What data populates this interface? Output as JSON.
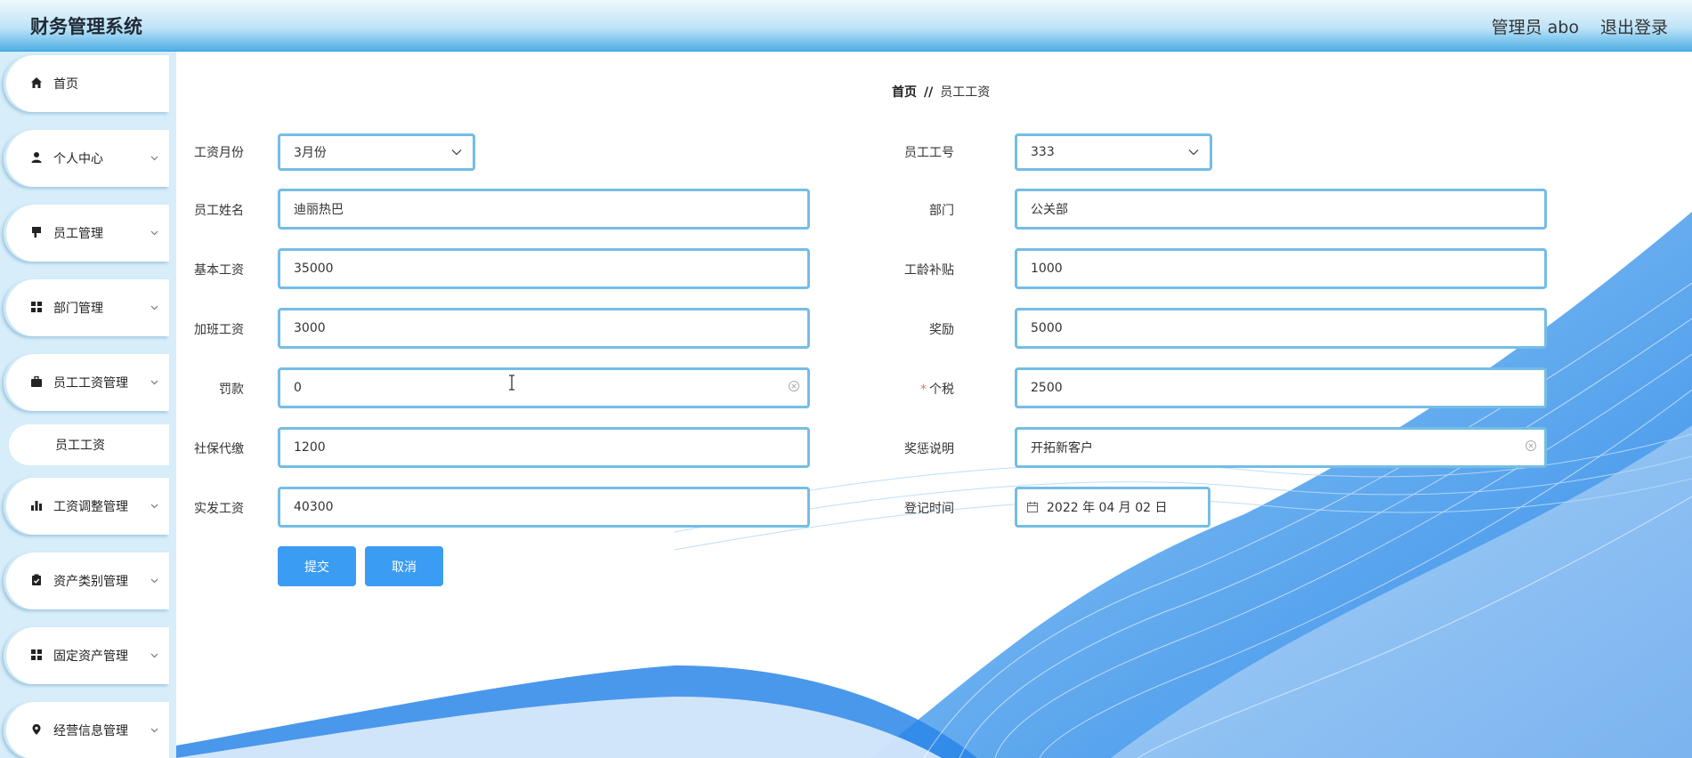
{
  "header": {
    "title": "财务管理系统",
    "admin_label": "管理员 abo",
    "logout_label": "退出登录"
  },
  "sidebar": {
    "items": [
      {
        "label": "首页",
        "icon": "home-icon"
      },
      {
        "label": "个人中心",
        "icon": "user-icon"
      },
      {
        "label": "员工管理",
        "icon": "pin-icon"
      },
      {
        "label": "部门管理",
        "icon": "grid-icon"
      },
      {
        "label": "员工工资管理",
        "icon": "briefcase-icon"
      },
      {
        "label": "工资调整管理",
        "icon": "bar-chart-icon"
      },
      {
        "label": "资产类别管理",
        "icon": "clipboard-icon"
      },
      {
        "label": "固定资产管理",
        "icon": "grid-icon"
      },
      {
        "label": "经营信息管理",
        "icon": "location-icon"
      }
    ],
    "subitem": {
      "label": "员工工资"
    }
  },
  "breadcrumb": {
    "home": "首页",
    "separator": "//",
    "current": "员工工资"
  },
  "form": {
    "salary_month": {
      "label": "工资月份",
      "value": "3月份"
    },
    "employee_id": {
      "label": "员工工号",
      "value": "333"
    },
    "employee_name": {
      "label": "员工姓名",
      "value": "迪丽热巴"
    },
    "department": {
      "label": "部门",
      "value": "公关部"
    },
    "base_salary": {
      "label": "基本工资",
      "value": "35000"
    },
    "seniority_allowance": {
      "label": "工龄补贴",
      "value": "1000"
    },
    "overtime_pay": {
      "label": "加班工资",
      "value": "3000"
    },
    "bonus": {
      "label": "奖励",
      "value": "5000"
    },
    "penalty": {
      "label": "罚款",
      "value": "0"
    },
    "income_tax": {
      "label": "个税",
      "required_mark": "*",
      "value": "2500"
    },
    "social_insurance": {
      "label": "社保代缴",
      "value": "1200"
    },
    "reward_note": {
      "label": "奖惩说明",
      "value": "开拓新客户"
    },
    "net_salary": {
      "label": "实发工资",
      "value": "40300"
    },
    "register_date": {
      "label": "登记时间",
      "value": "2022 年 04 月 02 日"
    }
  },
  "buttons": {
    "submit": "提交",
    "cancel": "取消"
  },
  "colors": {
    "accent": "#3a9cf3",
    "field_border": "#74bde6",
    "sidebar_bg": "#d7edf9",
    "required": "#f56c6c"
  }
}
